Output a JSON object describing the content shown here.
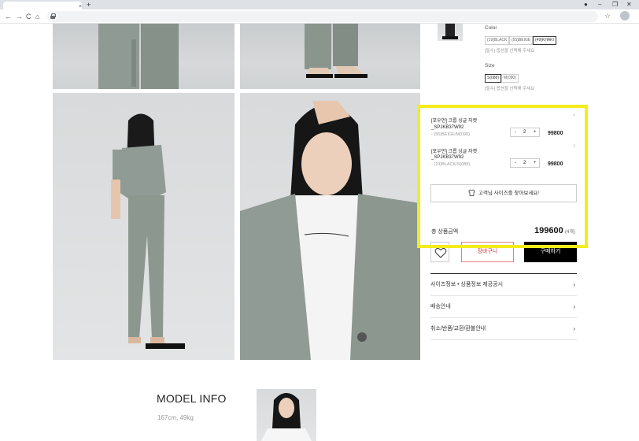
{
  "browser": {
    "tab_close": "×",
    "new_tab": "+",
    "back": "←",
    "forward": "→",
    "reload": "C",
    "home": "⌂",
    "bookmark_star": "☆",
    "win_controls": [
      "●",
      "–",
      "❐",
      "✕"
    ]
  },
  "product": {
    "color_label": "Color",
    "colors": [
      "(19)BLACK",
      "(55)BEIGE",
      "(49)KHAKI"
    ],
    "selected_color": "(49)KHAKI",
    "color_notice": "[필수] 옵션을 선택해 주세요",
    "size_label": "Size",
    "sizes": [
      "S(088)",
      "M(090)"
    ],
    "selected_size": "S(088)",
    "size_notice": "[필수] 옵션을 선택해 주세요"
  },
  "selected_items": [
    {
      "name": "[포우먼] 크롭 싱글 자켓",
      "code": "_SPJKB37W92",
      "option": "- (55)BEIGE/M(090)",
      "qty": "2",
      "price": "99800",
      "remove": "×"
    },
    {
      "name": "[포우먼] 크롭 싱글 자켓",
      "code": "_SPJKB37W92",
      "option": "- (19)BLACK/S(088)",
      "qty": "2",
      "price": "99800",
      "remove": "×"
    }
  ],
  "stepper": {
    "minus": "-",
    "plus": "+"
  },
  "find_size_button": "고객님 사이즈를 찾아보세요!",
  "total": {
    "label": "총 상품금액",
    "price": "199600",
    "count": "(4개)"
  },
  "buttons": {
    "wishlist": "♡",
    "cart": "장바구니",
    "buy": "구매하기"
  },
  "accordion": [
    {
      "label": "사이즈정보 • 상품정보 제공공시",
      "chevron": "›"
    },
    {
      "label": "배송안내",
      "chevron": "›"
    },
    {
      "label": "취소/반품/교환/환불안내",
      "chevron": "›"
    }
  ],
  "model": {
    "title": "MODEL INFO",
    "stats": "167cm, 49kg"
  },
  "colors": {
    "highlight": "#f5ec1d",
    "buy_bg": "#000000",
    "cart_border": "#e57f7f"
  }
}
